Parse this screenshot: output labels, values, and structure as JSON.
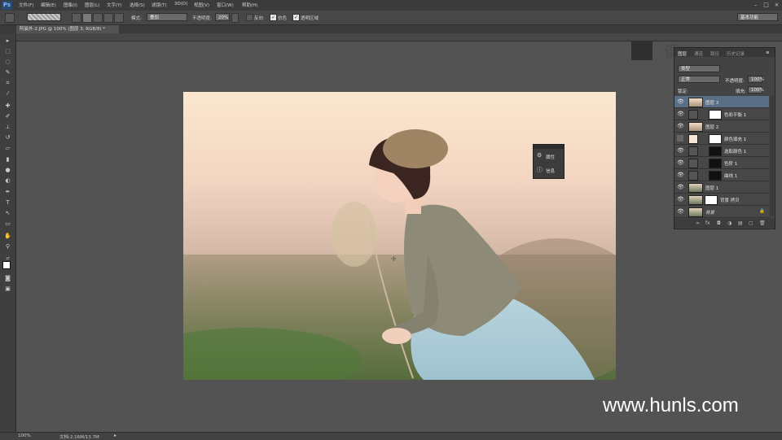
{
  "app": {
    "logo": "Ps"
  },
  "menu": [
    "文件(F)",
    "编辑(E)",
    "图像(I)",
    "图层(L)",
    "文字(Y)",
    "选择(S)",
    "滤镜(T)",
    "3D(D)",
    "视图(V)",
    "窗口(W)",
    "帮助(H)"
  ],
  "options": {
    "mode_label": "模式:",
    "mode_value": "叠加",
    "opacity_label": "不透明度:",
    "opacity_value": "20%",
    "reverse_label": "反向",
    "dither_label": "仿色",
    "transparency_label": "透明区域",
    "workspace_value": "基本功能"
  },
  "document": {
    "tab_title": "阿晨外-2.JPG @ 100% (图层 3, RGB/8) *"
  },
  "float_panel": {
    "properties_label": "属性",
    "info_label": "信息"
  },
  "layers": {
    "tabs": [
      "图层",
      "通道",
      "路径",
      "历史记录"
    ],
    "filter_value": "类型",
    "blend_value": "正常",
    "opacity_label": "不透明度:",
    "opacity_value": "100%",
    "lock_label": "锁定:",
    "fill_label": "填充:",
    "fill_value": "100%",
    "items": [
      {
        "name": "图层 3",
        "active": true
      },
      {
        "name": "色彩平衡 1"
      },
      {
        "name": "图层 2"
      },
      {
        "name": "颜色填充 1"
      },
      {
        "name": "选取颜色 1"
      },
      {
        "name": "色阶 1"
      },
      {
        "name": "曲线 1"
      },
      {
        "name": "图层 1"
      },
      {
        "name": "背景 拷贝"
      },
      {
        "name": "背景"
      }
    ]
  },
  "status": {
    "zoom": "100%",
    "doc_size": "文档:2.16M/13.7M"
  },
  "watermark": {
    "text": "www.hunls.com",
    "logo_text": "课堂"
  },
  "colors": {
    "menubar": "#3b3b3b",
    "workspace": "#535353",
    "panel": "#434343",
    "active_layer": "#5a6e86"
  }
}
